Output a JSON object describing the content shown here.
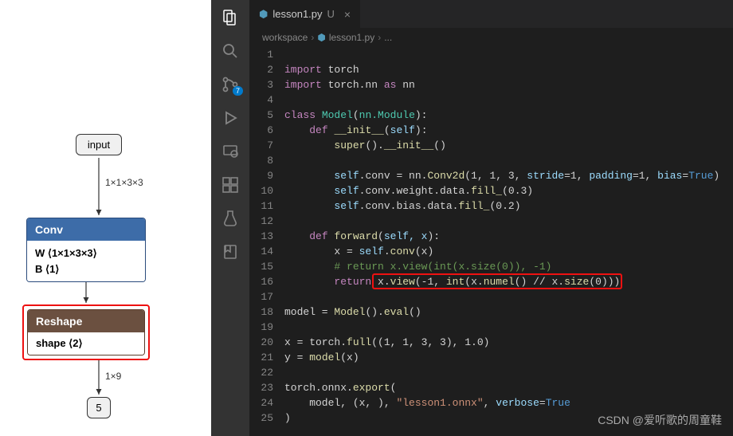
{
  "diagram": {
    "input_label": "input",
    "edge1_label": "1×1×3×3",
    "conv": {
      "title": "Conv",
      "w": "W ⟨1×1×3×3⟩",
      "b": "B ⟨1⟩"
    },
    "reshape": {
      "title": "Reshape",
      "shape": "shape ⟨2⟩"
    },
    "edge2_label": "1×9",
    "output_label": "5"
  },
  "editor": {
    "tab": {
      "filename": "lesson1.py",
      "modified": "U",
      "close": "×"
    },
    "breadcrumb": {
      "root": "workspace",
      "file": "lesson1.py",
      "more": "..."
    },
    "badge": "7",
    "line_count": 25,
    "code": {
      "l2": {
        "kw1": "import",
        "m": "torch"
      },
      "l3": {
        "kw1": "import",
        "m": "torch.nn",
        "kw2": "as",
        "a": "nn"
      },
      "l5": {
        "kw": "class",
        "name": "Model",
        "base": "nn.Module"
      },
      "l6": {
        "kw": "def",
        "name": "__init__",
        "p": "self"
      },
      "l7": {
        "fn": "super",
        "call": "().",
        "init": "__init__",
        "tail": "()"
      },
      "l9": {
        "s": "self",
        "a": ".conv = nn.",
        "fn": "Conv2d",
        "args": "(1, 1, 3, ",
        "p1": "stride",
        "v1": "=1, ",
        "p2": "padding",
        "v2": "=1, ",
        "p3": "bias",
        "v3": "=",
        "b": "True",
        "end": ")"
      },
      "l10": {
        "s": "self",
        "t": ".conv.weight.data.",
        "fn": "fill_",
        "arg": "(0.3)"
      },
      "l11": {
        "s": "self",
        "t": ".conv.bias.data.",
        "fn": "fill_",
        "arg": "(0.2)"
      },
      "l13": {
        "kw": "def",
        "name": "forward",
        "p": "self, x"
      },
      "l14": {
        "t": "x = ",
        "s": "self",
        "t2": ".",
        "fn": "conv",
        "arg": "(x)"
      },
      "l15": "# return x.view(int(x.size(0)), -1)",
      "l16": {
        "kw": "return",
        "t": " x.",
        "fn": "view",
        "a1": "(-1, ",
        "fn2": "int",
        "a2": "(x.",
        "fn3": "numel",
        "a3": "() // x.",
        "fn4": "size",
        "a4": "(0)))"
      },
      "l18": {
        "t": "model = ",
        "fn": "Model",
        "t2": "().",
        "fn2": "eval",
        "t3": "()"
      },
      "l20": {
        "t": "x = torch.",
        "fn": "full",
        "a": "((1, 1, 3, 3), 1.0)"
      },
      "l21": {
        "t": "y = ",
        "fn": "model",
        "a": "(x)"
      },
      "l23": {
        "t": "torch.onnx.",
        "fn": "export",
        "a": "("
      },
      "l24": {
        "t": "    model, (x, ), ",
        "s": "\"lesson1.onnx\"",
        "t2": ", ",
        "p": "verbose",
        "v": "=",
        "b": "True"
      },
      "l25": ")"
    }
  },
  "watermark": "CSDN @爱听歌的周童鞋"
}
